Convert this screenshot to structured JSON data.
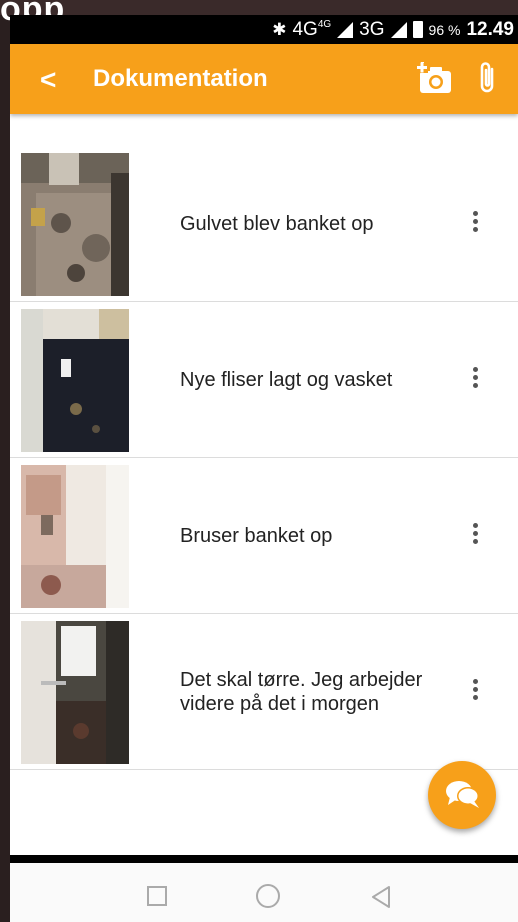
{
  "background_title": "opp",
  "status_bar": {
    "bluetooth": "✱",
    "network_4g": "4G",
    "network_4g_sup": "4G",
    "network_3g": "3G",
    "battery_percent": "96 %",
    "time": "12.49"
  },
  "app_bar": {
    "back_glyph": "<",
    "title": "Dokumentation"
  },
  "items": [
    {
      "label": "Gulvet blev banket op",
      "thumb": "floor-debris"
    },
    {
      "label": "Nye fliser lagt og vasket",
      "thumb": "dark-tiles"
    },
    {
      "label": "Bruser banket op",
      "thumb": "shower-wall"
    },
    {
      "label": "Det skal tørre. Jeg arbejder videre på det i morgen",
      "thumb": "drying-wall"
    }
  ],
  "icons": {
    "back": "chevron-left-icon",
    "add_photo": "add-camera-icon",
    "attach": "paperclip-icon",
    "more": "more-vertical-icon",
    "chat": "chat-bubbles-icon"
  },
  "colors": {
    "accent": "#f7a01a",
    "statusbar": "#000000",
    "text": "#222222",
    "divider": "#dcdcdc"
  }
}
